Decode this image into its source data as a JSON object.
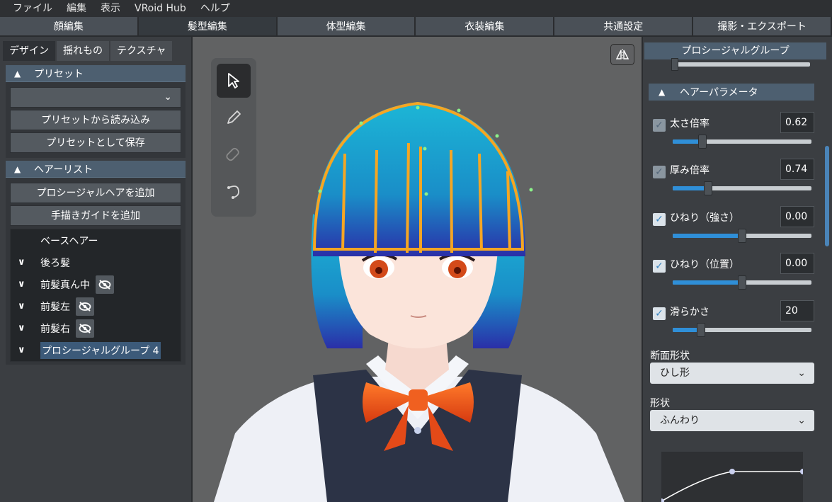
{
  "menu": [
    "ファイル",
    "編集",
    "表示",
    "VRoid Hub",
    "ヘルプ"
  ],
  "main_tabs": [
    {
      "label": "顔編集",
      "active": false
    },
    {
      "label": "髪型編集",
      "active": true
    },
    {
      "label": "体型編集",
      "active": false
    },
    {
      "label": "衣装編集",
      "active": false
    },
    {
      "label": "共通設定",
      "active": false
    },
    {
      "label": "撮影・エクスポート",
      "active": false
    }
  ],
  "left": {
    "sub_tabs": [
      "デザイン",
      "揺れもの",
      "テクスチャ"
    ],
    "preset": {
      "header": "プリセット",
      "dropdown_value": "",
      "load_button": "プリセットから読み込み",
      "save_button": "プリセットとして保存"
    },
    "hairlist": {
      "header": "ヘアーリスト",
      "add_procedural": "プロシージャルヘアを追加",
      "add_guide": "手描きガイドを追加",
      "items": [
        {
          "label": "ベースヘアー",
          "has_caret": false,
          "hidden": false
        },
        {
          "label": "後ろ髪",
          "has_caret": true,
          "hidden": false
        },
        {
          "label": "前髪真ん中",
          "has_caret": true,
          "hidden": true
        },
        {
          "label": "前髪左",
          "has_caret": true,
          "hidden": true
        },
        {
          "label": "前髪右",
          "has_caret": true,
          "hidden": true
        },
        {
          "label": "プロシージャルグループ 4",
          "has_caret": true,
          "hidden": false,
          "selected": true
        }
      ]
    }
  },
  "viewport": {
    "tools": [
      "select-tool",
      "pen-tool",
      "eraser-tool",
      "smooth-tool"
    ],
    "active_tool": "select-tool",
    "highlight_color": "#f5a623",
    "hair_color": "#1aa0c8"
  },
  "right": {
    "group_header": "プロシージャルグループ",
    "params_header": "ヘアーパラメータ",
    "params": [
      {
        "label": "太さ倍率",
        "value": "0.62",
        "checked": true,
        "enabled": false,
        "fraction": 0.21
      },
      {
        "label": "厚み倍率",
        "value": "0.74",
        "checked": true,
        "enabled": false,
        "fraction": 0.25
      },
      {
        "label": "ひねり（強さ）",
        "value": "0.00",
        "checked": true,
        "enabled": true,
        "fraction": 0.5
      },
      {
        "label": "ひねり（位置）",
        "value": "0.00",
        "checked": true,
        "enabled": true,
        "fraction": 0.5
      },
      {
        "label": "滑らかさ",
        "value": "20",
        "checked": true,
        "enabled": true,
        "fraction": 0.2
      }
    ],
    "cross_section_label": "断面形状",
    "cross_section_value": "ひし形",
    "shape_label": "形状",
    "shape_value": "ふんわり"
  }
}
